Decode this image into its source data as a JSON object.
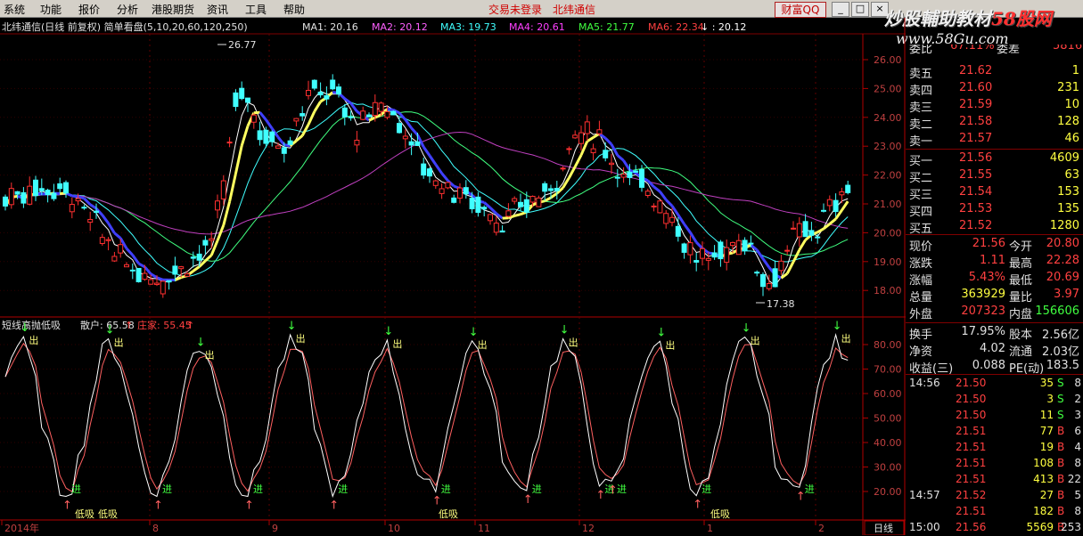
{
  "menu": {
    "items": [
      "系统",
      "功能",
      "报价",
      "分析",
      "港股期货",
      "资讯",
      "工具",
      "帮助"
    ],
    "notice": "交易未登录",
    "broker": "北纬通信",
    "wealth_button": "财富QQ",
    "win_controls": [
      "_",
      "□",
      "×"
    ]
  },
  "watermark": {
    "line1_a": "炒股輔助教材",
    "line1_b": "58股网",
    "line2": "www.58Gu.com"
  },
  "chart": {
    "title": "北纬通信(日线 前复权) 简单看盘(5,10,20,60,120,250)",
    "ma_labels": [
      {
        "text": "MA1: 20.16",
        "color": "#e0e0e0"
      },
      {
        "text": "MA2: 20.12",
        "color": "#ff60ff"
      },
      {
        "text": "MA3: 19.73",
        "color": "#40ffff"
      },
      {
        "text": "MA4: 20.61",
        "color": "#ff40ff"
      },
      {
        "text": "MA5: 21.77",
        "color": "#40ff40"
      },
      {
        "text": "MA6: 22.34",
        "color": "#ff4040"
      },
      {
        "text": "↓ : 20.12",
        "color": "#ffffff"
      }
    ],
    "max_label": "26.77",
    "min_label": "17.38",
    "price_axis": [
      "26.00",
      "25.00",
      "24.00",
      "23.00",
      "22.00",
      "21.00",
      "20.00",
      "19.00",
      "18.00"
    ],
    "indicator_title": "短线高抛低吸",
    "indicator_labels": [
      {
        "text": "散户: 65.58",
        "color": "#e0e0e0"
      },
      {
        "text": "庄家: 55.45",
        "color": "#ff4040"
      }
    ],
    "indicator_axis": [
      "80.00",
      "70.00",
      "60.00",
      "50.00",
      "40.00",
      "30.00",
      "20.00"
    ],
    "signal_out": "出",
    "signal_in": "进",
    "signal_low": "低吸",
    "date_axis": [
      "2014年",
      "8",
      "9",
      "10",
      "11",
      "12",
      "1",
      "2"
    ],
    "period_button": "日线"
  },
  "quote": {
    "top_partial": {
      "label": "委比",
      "value": "67.11%",
      "label2": "委差",
      "value2": "5816"
    },
    "sells": [
      {
        "label": "卖五",
        "price": "21.62",
        "vol": "1"
      },
      {
        "label": "卖四",
        "price": "21.60",
        "vol": "231"
      },
      {
        "label": "卖三",
        "price": "21.59",
        "vol": "10"
      },
      {
        "label": "卖二",
        "price": "21.58",
        "vol": "128"
      },
      {
        "label": "卖一",
        "price": "21.57",
        "vol": "46"
      }
    ],
    "buys": [
      {
        "label": "买一",
        "price": "21.56",
        "vol": "4609"
      },
      {
        "label": "买二",
        "price": "21.55",
        "vol": "63"
      },
      {
        "label": "买三",
        "price": "21.54",
        "vol": "153"
      },
      {
        "label": "买四",
        "price": "21.53",
        "vol": "135"
      },
      {
        "label": "买五",
        "price": "21.52",
        "vol": "1280"
      }
    ],
    "stats": [
      {
        "l1": "现价",
        "v1": "21.56",
        "c1": "#ff4040",
        "l2": "今开",
        "v2": "20.80",
        "c2": "#ff4040"
      },
      {
        "l1": "涨跌",
        "v1": "1.11",
        "c1": "#ff4040",
        "l2": "最高",
        "v2": "22.28",
        "c2": "#ff4040"
      },
      {
        "l1": "涨幅",
        "v1": "5.43%",
        "c1": "#ff4040",
        "l2": "最低",
        "v2": "20.69",
        "c2": "#ff4040"
      },
      {
        "l1": "总量",
        "v1": "363929",
        "c1": "#ffff40",
        "l2": "量比",
        "v2": "3.97",
        "c2": "#ff4040"
      },
      {
        "l1": "外盘",
        "v1": "207323",
        "c1": "#ff4040",
        "l2": "内盘",
        "v2": "156606",
        "c2": "#40ff40"
      }
    ],
    "stats2": [
      {
        "l1": "换手",
        "v1": "17.95%",
        "c1": "#e0e0e0",
        "l2": "股本",
        "v2": "2.56亿",
        "c2": "#e0e0e0"
      },
      {
        "l1": "净资",
        "v1": "4.02",
        "c1": "#e0e0e0",
        "l2": "流通",
        "v2": "2.03亿",
        "c2": "#e0e0e0"
      },
      {
        "l1": "收益(三)",
        "v1": "0.088",
        "c1": "#e0e0e0",
        "l2": "PE(动)",
        "v2": "183.5",
        "c2": "#e0e0e0"
      }
    ],
    "ticks": [
      {
        "time": "14:56",
        "price": "21.50",
        "vol": "35",
        "side": "S",
        "n": "8"
      },
      {
        "time": "",
        "price": "21.50",
        "vol": "3",
        "side": "S",
        "n": "2"
      },
      {
        "time": "",
        "price": "21.50",
        "vol": "11",
        "side": "S",
        "n": "3"
      },
      {
        "time": "",
        "price": "21.51",
        "vol": "77",
        "side": "B",
        "n": "6"
      },
      {
        "time": "",
        "price": "21.51",
        "vol": "19",
        "side": "B",
        "n": "4"
      },
      {
        "time": "",
        "price": "21.51",
        "vol": "108",
        "side": "B",
        "n": "8"
      },
      {
        "time": "",
        "price": "21.51",
        "vol": "413",
        "side": "B",
        "n": "22"
      },
      {
        "time": "14:57",
        "price": "21.52",
        "vol": "27",
        "side": "B",
        "n": "5"
      },
      {
        "time": "",
        "price": "21.51",
        "vol": "182",
        "side": "B",
        "n": "8"
      },
      {
        "time": "15:00",
        "price": "21.56",
        "vol": "5569",
        "side": "B",
        "n": "253"
      }
    ]
  }
}
